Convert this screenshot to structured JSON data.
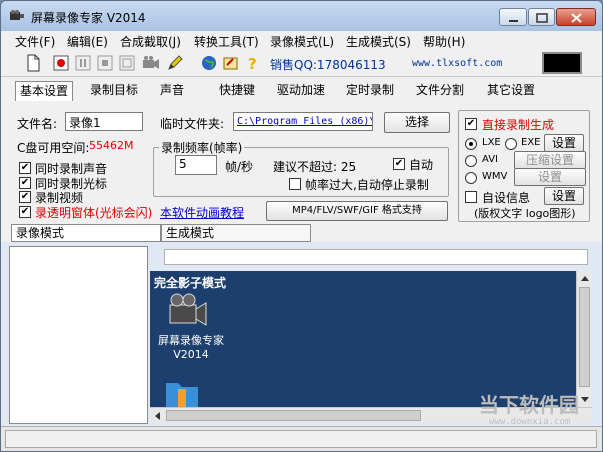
{
  "window": {
    "title": "屏幕录像专家 V2014"
  },
  "menu": [
    "文件(F)",
    "编辑(E)",
    "合成截取(J)",
    "转换工具(T)",
    "录像模式(L)",
    "生成模式(S)",
    "帮助(H)"
  ],
  "toolbar": {
    "qq": "销售QQ:178046113",
    "site": "www.tlxsoft.com"
  },
  "tabs": [
    "基本设置",
    "录制目标",
    "声音",
    "快捷键",
    "驱动加速",
    "定时录制",
    "文件分割",
    "其它设置"
  ],
  "basic": {
    "filename_label": "文件名:",
    "filename_value": "录像1",
    "tempdir_label": "临时文件夹:",
    "tempdir_value": "C:\\Program Files (x86)\\",
    "select_button": "选择",
    "disk_label": "C盘可用空间:",
    "disk_value": "55462M",
    "checks": [
      "同时录制声音",
      "同时录制光标",
      "录制视频"
    ],
    "transparent": "录透明窗体(光标会闪)",
    "tutorial_link": "本软件动画教程",
    "format_button": "MP4/FLV/SWF/GIF  格式支持",
    "fps_group": "录制频率(帧率)",
    "fps_value": "5",
    "fps_unit": "帧/秒",
    "suggest": "建议不超过: 25",
    "auto": "自动",
    "auto_stop": "帧率过大,自动停止录制"
  },
  "direct": {
    "title": "直接录制生成",
    "formats": [
      "LXE",
      "EXE",
      "AVI",
      "WMV"
    ],
    "btn_setting": "设置",
    "btn_compress": "压缩设置",
    "btn_setting2": "设置",
    "custom_info": "自设信息",
    "btn_setting3": "设置",
    "note": "(版权文字 logo图形)"
  },
  "lower_tabs": [
    "录像模式",
    "生成模式"
  ],
  "preview": {
    "title": "完全影子模式",
    "desktop_icon_label": "屏幕录像专家V2014"
  },
  "watermark": {
    "text": "当下软件园",
    "url": "www.downxia.com"
  }
}
